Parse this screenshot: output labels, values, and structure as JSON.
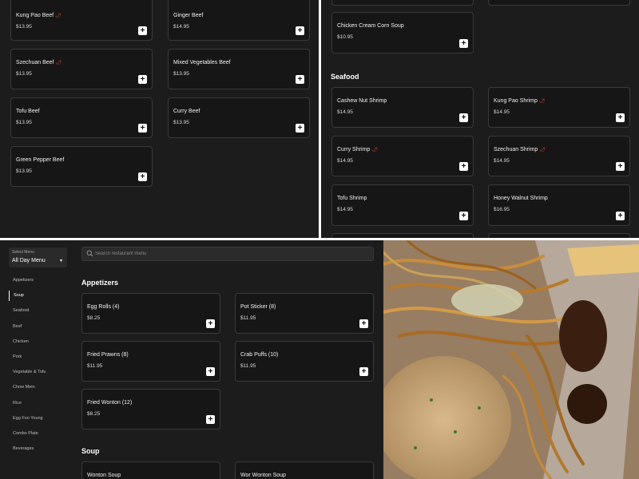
{
  "panel1": {
    "cards": [
      {
        "name": "Kung Pao Beef",
        "price": "$13.95",
        "spicy": true
      },
      {
        "name": "Ginger Beef",
        "price": "$14.95",
        "spicy": false
      },
      {
        "name": "Szechuan Beef",
        "price": "$13.95",
        "spicy": true
      },
      {
        "name": "Mixed Vegetables Beef",
        "price": "$13.95",
        "spicy": false
      },
      {
        "name": "Tofu Beef",
        "price": "$13.95",
        "spicy": false
      },
      {
        "name": "Curry Beef",
        "price": "$13.95",
        "spicy": false
      },
      {
        "name": "Green Pepper Beef",
        "price": "$13.95",
        "spicy": false
      }
    ]
  },
  "panel2": {
    "soup_cards": [
      {
        "name": "Chicken Cream Corn Soup",
        "price": "$10.95",
        "spicy": false
      }
    ],
    "section_title": "Seafood",
    "cards": [
      {
        "name": "Cashew Nut Shrimp",
        "price": "$14.95",
        "spicy": false
      },
      {
        "name": "Kung Pao Shrimp",
        "price": "$14.95",
        "spicy": true
      },
      {
        "name": "Curry Shrimp",
        "price": "$14.95",
        "spicy": true
      },
      {
        "name": "Szechuan Shrimp",
        "price": "$14.95",
        "spicy": true
      },
      {
        "name": "Tofu Shrimp",
        "price": "$14.95",
        "spicy": false
      },
      {
        "name": "Honey Walnut Shrimp",
        "price": "$16.95",
        "spicy": false
      }
    ]
  },
  "panel3": {
    "menu_select": {
      "label": "Select Menu",
      "value": "All Day Menu"
    },
    "nav": [
      "Appetizers",
      "Soup",
      "Seafood",
      "Beef",
      "Chicken",
      "Pork",
      "Vegetable & Tofu",
      "Chow Mein",
      "Rice",
      "Egg Foo Young",
      "Combo Plate",
      "Beverages"
    ],
    "active_nav": "Soup",
    "search_placeholder": "Search restaurant menu",
    "appetizers_title": "Appetizers",
    "appetizers": [
      {
        "name": "Egg Rolls (4)",
        "price": "$8.25"
      },
      {
        "name": "Pot Sticker (8)",
        "price": "$11.95"
      },
      {
        "name": "Fried Prawns (8)",
        "price": "$11.95"
      },
      {
        "name": "Crab Puffs (10)",
        "price": "$11.95"
      },
      {
        "name": "Fried Wonton (12)",
        "price": "$8.25"
      }
    ],
    "soup_title": "Soup",
    "soups": [
      {
        "name": "Wonton Soup"
      },
      {
        "name": "Wor Wonton Soup"
      }
    ]
  },
  "add_symbol": "+",
  "spicy_symbol": "🌶",
  "colors": {
    "background": "#1c1c1c",
    "card": "#161616",
    "border": "#3a3a3a",
    "spicy": "#d9432c",
    "add_button": "#ffffff"
  },
  "photo": {
    "subject": "chow mein noodles, fried rice and beef on a white plate"
  }
}
